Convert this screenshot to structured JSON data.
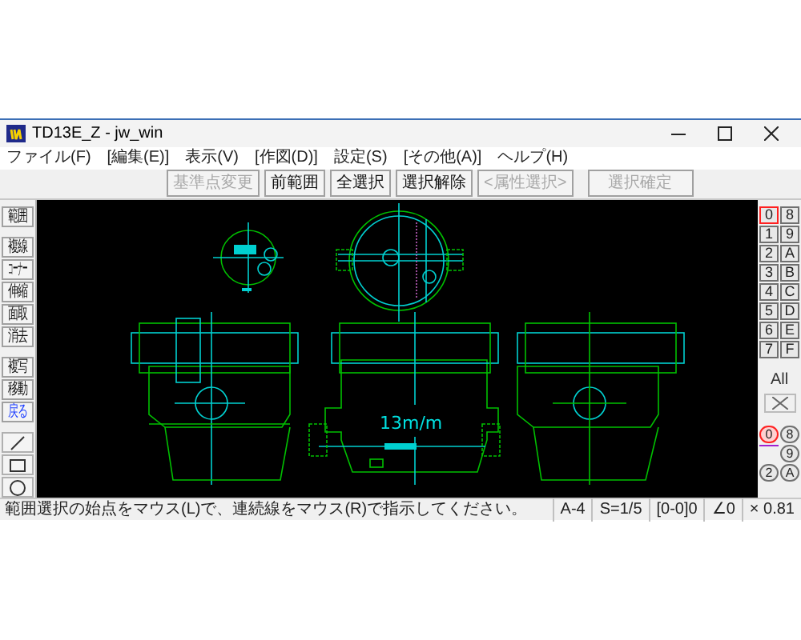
{
  "window": {
    "title": "TD13E_Z - jw_win"
  },
  "menu": [
    "ファイル(F)",
    "[編集(E)]",
    "表示(V)",
    "[作図(D)]",
    "設定(S)",
    "[その他(A)]",
    "ヘルプ(H)"
  ],
  "toolbar": [
    {
      "label": "基準点変更",
      "disabled": true
    },
    {
      "label": "前範囲",
      "disabled": false
    },
    {
      "label": "全選択",
      "disabled": false
    },
    {
      "label": "選択解除",
      "disabled": false
    },
    {
      "label": "<属性選択>",
      "disabled": true
    },
    {
      "label": "選択確定",
      "disabled": true
    }
  ],
  "tools": [
    {
      "kind": "command",
      "label": "範囲"
    },
    {
      "kind": "gap"
    },
    {
      "kind": "command",
      "label": "複線"
    },
    {
      "kind": "command",
      "label": "コーナー"
    },
    {
      "kind": "command",
      "label": "伸縮"
    },
    {
      "kind": "command",
      "label": "面取"
    },
    {
      "kind": "command",
      "label": "消去"
    },
    {
      "kind": "gap"
    },
    {
      "kind": "command",
      "label": "複写"
    },
    {
      "kind": "command",
      "label": "移動"
    },
    {
      "kind": "undo",
      "label": "戻る"
    },
    {
      "kind": "gap"
    },
    {
      "kind": "line"
    },
    {
      "kind": "rect"
    },
    {
      "kind": "circle"
    }
  ],
  "canvas": {
    "drawing_label": "13m/m"
  },
  "layers": [
    {
      "label": "0",
      "selected": true
    },
    {
      "label": "8",
      "selected": false
    },
    {
      "label": "1",
      "selected": false
    },
    {
      "label": "9",
      "selected": false
    },
    {
      "label": "2",
      "selected": false
    },
    {
      "label": "A",
      "selected": false
    },
    {
      "label": "3",
      "selected": false
    },
    {
      "label": "B",
      "selected": false
    },
    {
      "label": "4",
      "selected": false
    },
    {
      "label": "C",
      "selected": false
    },
    {
      "label": "5",
      "selected": false
    },
    {
      "label": "D",
      "selected": false
    },
    {
      "label": "6",
      "selected": false
    },
    {
      "label": "E",
      "selected": false
    },
    {
      "label": "7",
      "selected": false
    },
    {
      "label": "F",
      "selected": false
    }
  ],
  "layer_all": "All",
  "layer_groups": [
    {
      "kind": "group",
      "label": "0",
      "selected": true
    },
    {
      "kind": "group",
      "label": "8",
      "selected": false
    },
    {
      "kind": "indicator"
    },
    {
      "kind": "group",
      "label": "9",
      "selected": false
    },
    {
      "kind": "group",
      "label": "2",
      "selected": false
    },
    {
      "kind": "group",
      "label": "A",
      "selected": false
    }
  ],
  "status_bar": {
    "message": "範囲選択の始点をマウス(L)で、連続線をマウス(R)で指示してください。",
    "fields": [
      "A-4",
      "S=1/5",
      "[0-0]0",
      "∠0",
      "× 0.81"
    ]
  }
}
